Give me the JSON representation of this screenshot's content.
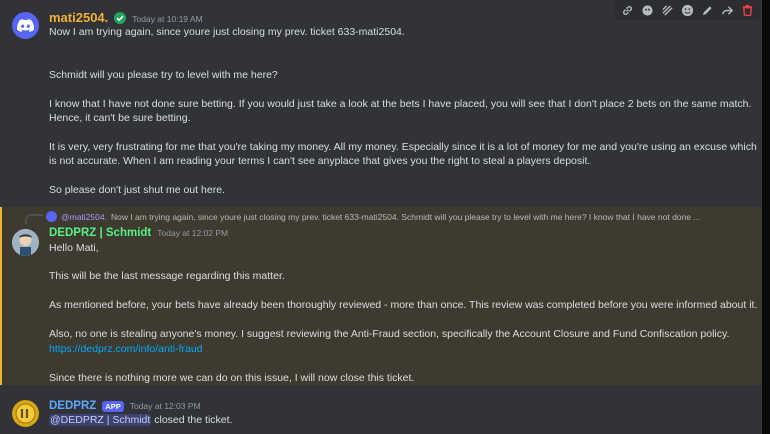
{
  "toolbar": {
    "icons": [
      "link-icon",
      "ticket-icon",
      "bars-icon",
      "emoji-icon",
      "edit-icon",
      "reply-icon",
      "delete-icon"
    ]
  },
  "msg1": {
    "username": "mati2504.",
    "timestamp": "Today at 10:19 AM",
    "name_color": "#f0b232",
    "lines": [
      "Now I am trying again, since youre just closing my prev. ticket 633-mati2504.",
      "Schmidt will you please try to level with me here?",
      "I know that I have not done sure betting. If you would just take a look at the bets I have placed, you will see that I don't place 2 bets on the same match.",
      "Hence, it can't be sure betting.",
      "It is very, very frustrating for me that you're taking my money. All my money. Especially since it is a lot of money for me and you're using an excuse which",
      "is not accurate. When I am reading your terms I can't see anyplace that gives you the right to steal a players deposit.",
      "So please don't just shut me out here."
    ]
  },
  "msg2": {
    "reply_name": "@mati2504.",
    "reply_text": "Now I am trying again, since youre just closing my prev. ticket 633-mati2504.    Schmidt will you please try to level with me here?  I know that I have not done ...",
    "username": "DEDPRZ | Schmidt",
    "timestamp": "Today at 12:02 PM",
    "name_color": "#57f287",
    "lines": [
      "Hello Mati,",
      "This will be the last message regarding this matter.",
      "As mentioned before, your bets have already been thoroughly reviewed - more than once. This review was completed before you were informed about it.",
      "Also, no one is stealing anyone's money. I suggest reviewing the Anti-Fraud section, specifically the Account Closure and Fund Confiscation policy.",
      "https://dedprz.com/info/anti-fraud",
      "Since there is nothing more we can do on this issue, I will now close this ticket."
    ]
  },
  "msg3": {
    "username": "DEDPRZ",
    "app_tag": "APP",
    "timestamp": "Today at 12:03 PM",
    "name_color": "#5aa9ff",
    "mention": "@DEDPRZ | Schmidt",
    "text": "closed the ticket."
  }
}
